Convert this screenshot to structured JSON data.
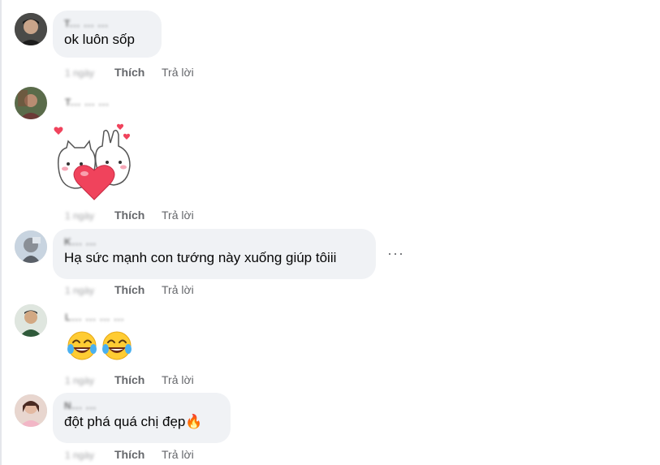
{
  "comments": [
    {
      "author": "T... ... ...",
      "text": "ok luôn sốp",
      "time": "1 ngày",
      "like_label": "Thích",
      "reply_label": "Trả lời"
    },
    {
      "author": "T... ... ...",
      "sticker": "heart-bears-sticker",
      "time": "1 ngày",
      "like_label": "Thích",
      "reply_label": "Trả lời"
    },
    {
      "author": "K... ...",
      "text": "Hạ sức mạnh con tướng này xuống giúp tôiii",
      "time": "1 ngày",
      "like_label": "Thích",
      "reply_label": "Trả lời",
      "more_label": "···"
    },
    {
      "author": "L... ... ... ...",
      "emojis": [
        "😂",
        "😂"
      ],
      "time": "1 ngày",
      "like_label": "Thích",
      "reply_label": "Trả lời"
    },
    {
      "author": "N... ...",
      "text": "đột phá quá chị đẹp🔥",
      "time": "1 ngày",
      "like_label": "Thích",
      "reply_label": "Trả lời"
    }
  ],
  "colors": {
    "bubble_bg": "#f0f2f5",
    "text": "#050505",
    "secondary": "#65676b",
    "heart": "#f0435c"
  }
}
